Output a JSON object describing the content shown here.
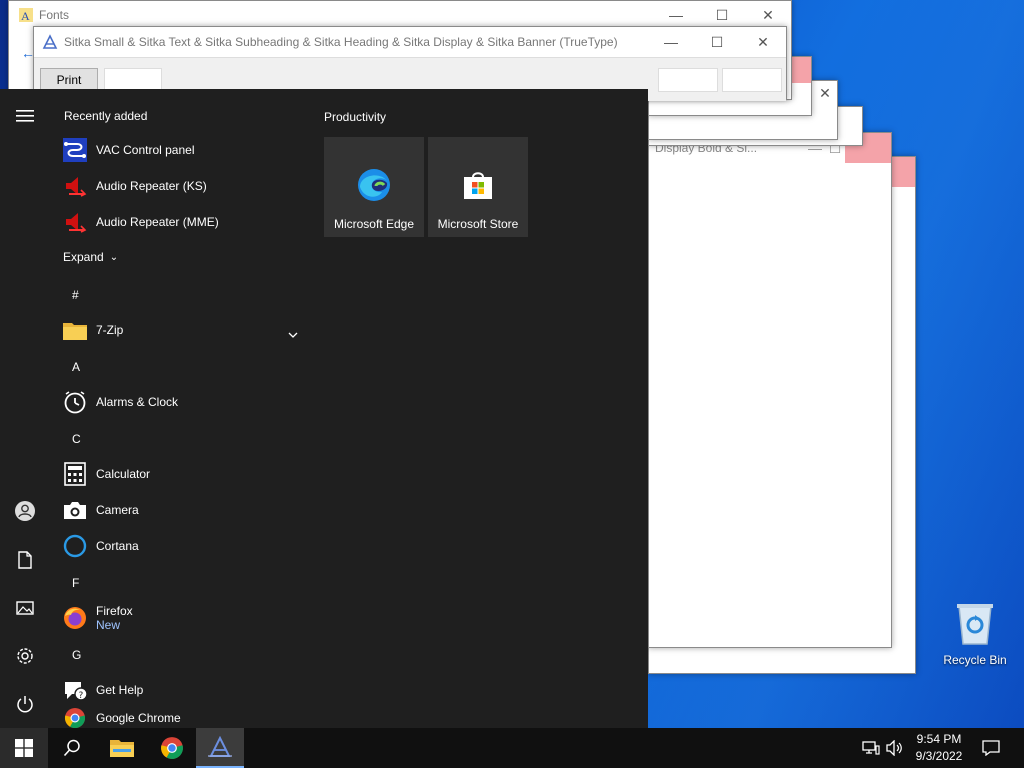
{
  "windows": {
    "fonts_title": "Fonts",
    "sitka_title": "Sitka Small & Sitka Text  & Sitka Subheading  & Sitka Heading  & Sitka Display  & Sitka Banner  (TrueType)",
    "print_label": "Print",
    "display_title": "Display Bold  & Si..."
  },
  "start_menu": {
    "recently_added_title": "Recently added",
    "recent": [
      {
        "label": "VAC Control panel",
        "icon": "vac-icon"
      },
      {
        "label": "Audio Repeater (KS)",
        "icon": "speaker-icon"
      },
      {
        "label": "Audio Repeater (MME)",
        "icon": "speaker-icon"
      }
    ],
    "expand_label": "Expand",
    "groups": [
      {
        "letter": "#",
        "apps": [
          {
            "label": "7-Zip",
            "icon": "folder-icon"
          }
        ]
      },
      {
        "letter": "A",
        "apps": [
          {
            "label": "Alarms & Clock",
            "icon": "clock-icon"
          }
        ]
      },
      {
        "letter": "C",
        "apps": [
          {
            "label": "Calculator",
            "icon": "calculator-icon"
          },
          {
            "label": "Camera",
            "icon": "camera-icon"
          },
          {
            "label": "Cortana",
            "icon": "cortana-icon"
          }
        ]
      },
      {
        "letter": "F",
        "apps": [
          {
            "label": "Firefox",
            "sub": "New",
            "icon": "firefox-icon"
          }
        ]
      },
      {
        "letter": "G",
        "apps": [
          {
            "label": "Get Help",
            "icon": "help-icon"
          },
          {
            "label": "Google Chrome",
            "icon": "chrome-icon"
          }
        ]
      }
    ],
    "tiles_title": "Productivity",
    "tiles": [
      {
        "label": "Microsoft Edge",
        "icon": "edge-icon"
      },
      {
        "label": "Microsoft Store",
        "icon": "store-icon"
      }
    ]
  },
  "desktop": {
    "recycle_bin": "Recycle Bin"
  },
  "taskbar": {
    "time": "9:54 PM",
    "date": "9/3/2022"
  }
}
